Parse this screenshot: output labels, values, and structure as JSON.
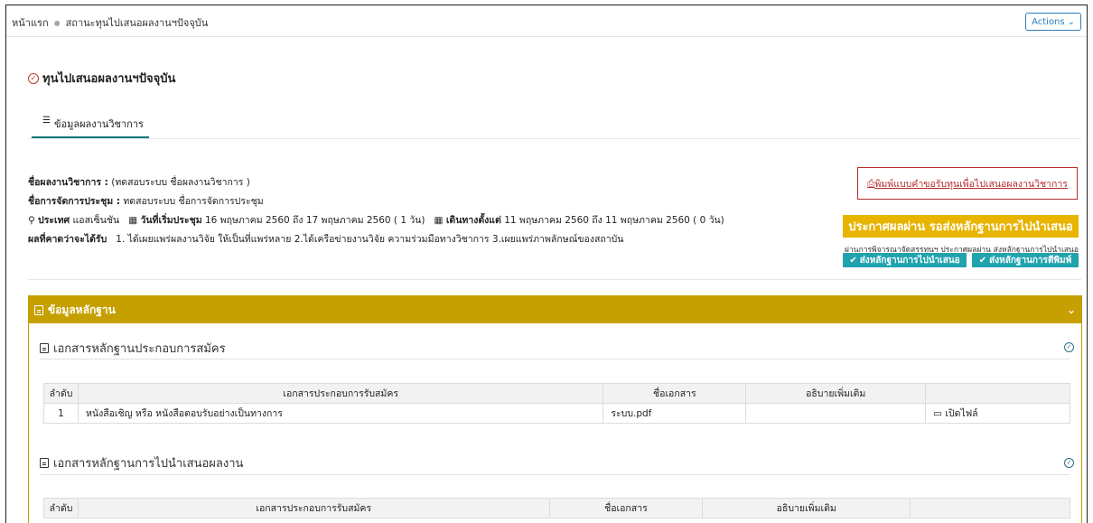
{
  "breadcrumb": {
    "home": "หน้าแรก",
    "current": "สถานะทุนไปเสนอผลงานฯปัจจุบัน"
  },
  "actions_label": "Actions",
  "page_title": "ทุนไปเสนอผลงานฯปัจจุบัน",
  "tab_label": "ข้อมูลผลงานวิชาการ",
  "info": {
    "work_name_label": "ชื่อผลงานวิชาการ :",
    "work_name_value": "(ทดสอบระบบ ชื่อผลงานวิชาการ )",
    "conference_label": "ชื่อการจัดการประชุม :",
    "conference_value": "ทดสอบระบบ ชื่อการจัดการประชุม",
    "country_label": "ประเทศ",
    "country_value": "แอสเซ็นชัน",
    "start_date_label": "วันที่เริ่มประชุม",
    "start_date_value": "16 พฤษภาคม 2560 ถึง 17 พฤษภาคม 2560 ( 1 วัน)",
    "travel_label": "เดินทางตั้งแต่",
    "travel_value": "11 พฤษภาคม 2560 ถึง 11 พฤษภาคม 2560 ( 0 วัน)",
    "expected_label": "ผลที่คาดว่าจะได้รับ",
    "expected_value": "1. ได้เผยแพร่ผลงานวิจัย ให้เป็นที่แพร่หลาย 2.ได้เครือข่ายงานวิจัย ความร่วมมือทางวิชาการ 3.เผยแพร่ภาพลักษณ์ของสถาบัน"
  },
  "print_button": "พิมพ์แบบคำขอรับทุนเพื่อไปเสนอผลงานวิชาการ",
  "announce_banner": "ประกาศผลผ่าน รอส่งหลักฐานการไปนำเสนอ",
  "note_text": "ผ่านการพิจารณาจัดสรรทุนฯ ประกาศผลผ่าน ส่งหลักฐานการไปนำเสนอ",
  "send_present_button": "ส่งหลักฐานการไปนำเสนอ",
  "send_publish_button": "ส่งหลักฐานการตีพิมพ์",
  "panel_title": "ข้อมูลหลักฐาน",
  "section1": {
    "title": "เอกสารหลักฐานประกอบการสมัคร",
    "headers": [
      "ลำดับ",
      "เอกสารประกอบการรับสมัคร",
      "ชื่อเอกสาร",
      "อธิบายเพิ่มเติม",
      ""
    ],
    "rows": [
      {
        "no": "1",
        "doc": "หนังสือเชิญ หรือ หนังสือตอบรับอย่างเป็นทางการ",
        "file": "ระบบ.pdf",
        "note": "",
        "action": "เปิดไฟล์"
      }
    ]
  },
  "section2": {
    "title": "เอกสารหลักฐานการไปนำเสนอผลงาน",
    "headers": [
      "ลำดับ",
      "เอกสารประกอบการรับสมัคร",
      "ชื่อเอกสาร",
      "อธิบายเพิ่มเติม",
      ""
    ]
  },
  "colors": {
    "teal": "#21a3ad",
    "gold": "#c5a000",
    "banner": "#e8b400",
    "red": "#b52c2c"
  }
}
